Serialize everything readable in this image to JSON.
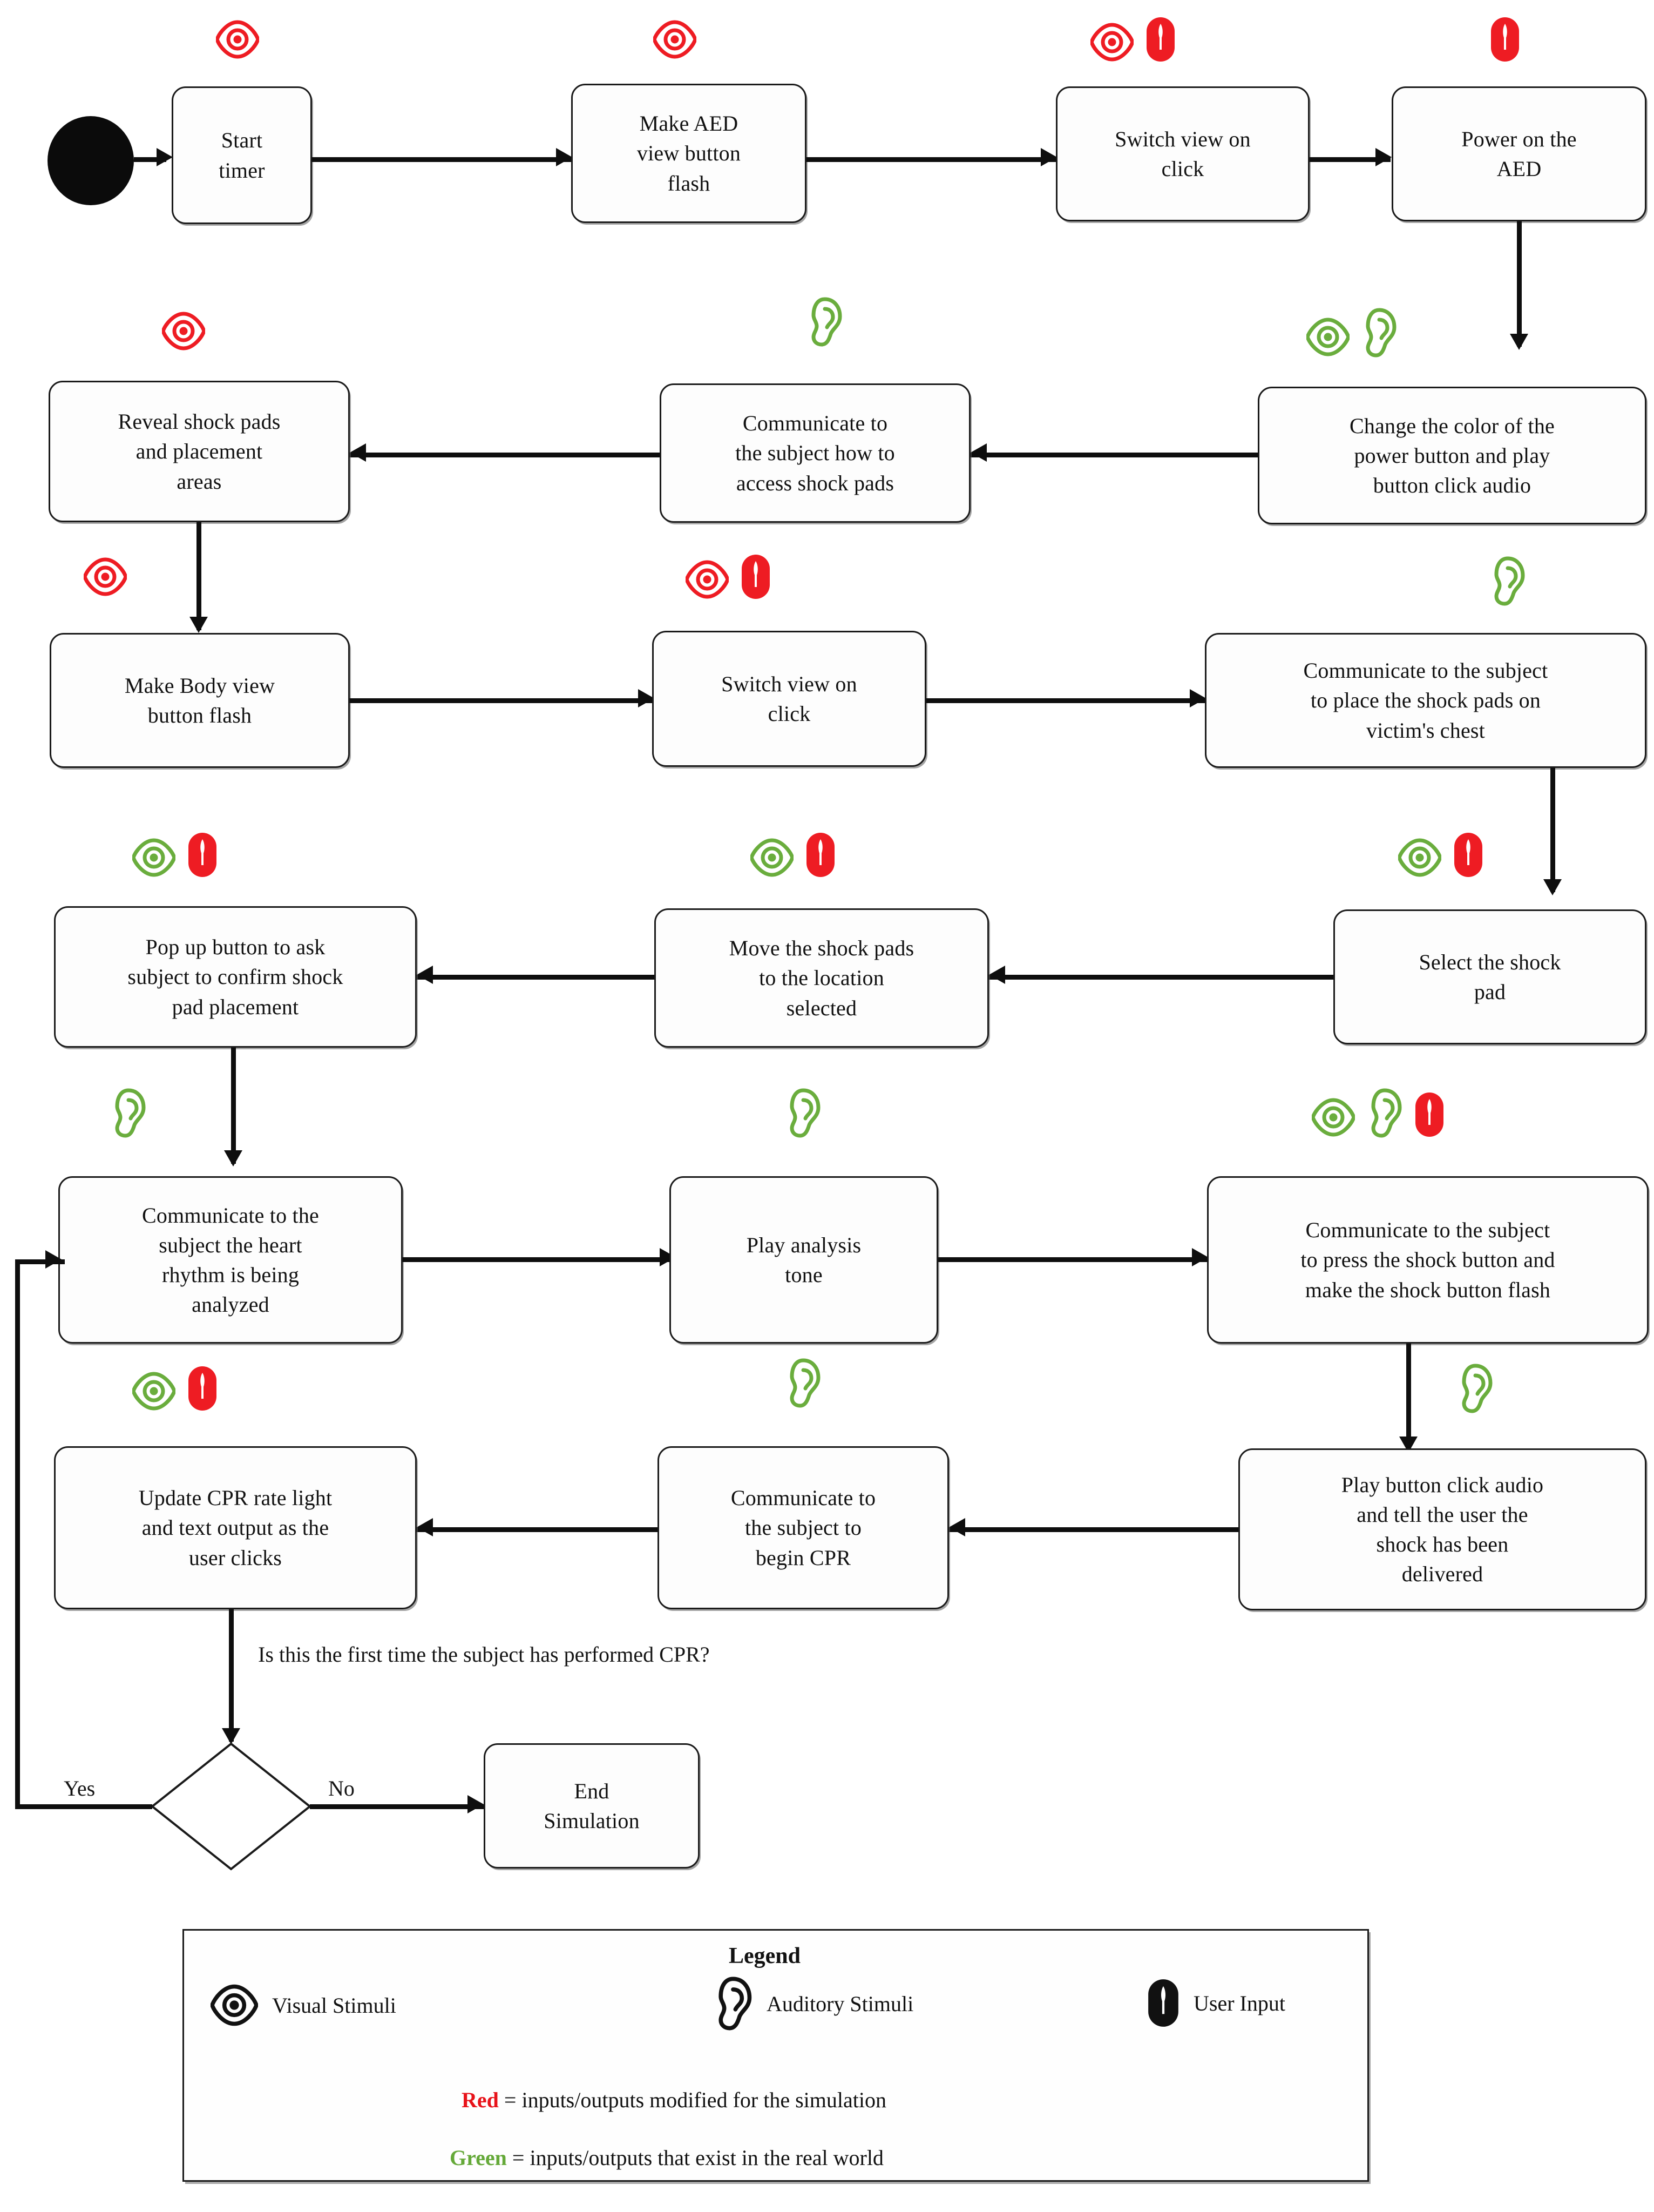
{
  "diagram": {
    "title": "AED simulation interaction flowchart",
    "colors": {
      "red": "#ee1c23",
      "green": "#6aad3d",
      "black": "#0e0e0e",
      "box_border": "#1a1a1a",
      "box_fill": "#fdfdfd"
    },
    "nodes": [
      {
        "id": "start",
        "label": "",
        "shape": "start-circle"
      },
      {
        "id": "n1",
        "label": "Start\ntimer",
        "shape": "process",
        "icons": [
          "eye-red"
        ]
      },
      {
        "id": "n2",
        "label": "Make  AED\nview button\nflash",
        "shape": "process",
        "icons": [
          "eye-red"
        ]
      },
      {
        "id": "n3",
        "label": "Switch view on\nclick",
        "shape": "process",
        "icons": [
          "eye-red",
          "mouse-red"
        ]
      },
      {
        "id": "n4",
        "label": "Power on the\nAED",
        "shape": "process",
        "icons": [
          "mouse-red"
        ]
      },
      {
        "id": "n5",
        "label": "Change the color of the\npower button and play\nbutton click audio",
        "shape": "process",
        "icons": [
          "eye-green",
          "ear-green"
        ]
      },
      {
        "id": "n6",
        "label": "Communicate to\nthe subject how to\naccess shock pads",
        "shape": "process",
        "icons": [
          "ear-green"
        ]
      },
      {
        "id": "n7",
        "label": "Reveal shock pads\nand placement\nareas",
        "shape": "process",
        "icons": [
          "eye-red"
        ]
      },
      {
        "id": "n8",
        "label": "Make Body view\nbutton flash",
        "shape": "process",
        "icons": [
          "eye-red"
        ]
      },
      {
        "id": "n9",
        "label": "Switch view on\nclick",
        "shape": "process",
        "icons": [
          "eye-red",
          "mouse-red"
        ]
      },
      {
        "id": "n10",
        "label": "Communicate to the subject\nto place the shock pads on\nvictim's chest",
        "shape": "process",
        "icons": [
          "ear-green"
        ]
      },
      {
        "id": "n11",
        "label": "Select the shock\npad",
        "shape": "process",
        "icons": [
          "eye-green",
          "mouse-red"
        ]
      },
      {
        "id": "n12",
        "label": "Move the shock pads\nto the location\nselected",
        "shape": "process",
        "icons": [
          "eye-green",
          "mouse-red"
        ]
      },
      {
        "id": "n13",
        "label": "Pop up button to ask\nsubject to confirm shock\npad placement",
        "shape": "process",
        "icons": [
          "eye-green",
          "mouse-red"
        ]
      },
      {
        "id": "n14",
        "label": "Communicate to the\nsubject the heart\nrhythm is being\nanalyzed",
        "shape": "process",
        "icons": [
          "ear-green"
        ]
      },
      {
        "id": "n15",
        "label": "Play analysis\ntone",
        "shape": "process",
        "icons": [
          "ear-green"
        ]
      },
      {
        "id": "n16",
        "label": "Communicate to the subject\nto press the shock button and\nmake the shock button flash",
        "shape": "process",
        "icons": [
          "eye-green",
          "ear-green",
          "mouse-red"
        ]
      },
      {
        "id": "n17",
        "label": "Play button click audio\nand tell the user the\nshock has been\ndelivered",
        "shape": "process",
        "icons": [
          "ear-green"
        ]
      },
      {
        "id": "n18",
        "label": "Communicate to\nthe subject to\nbegin CPR",
        "shape": "process",
        "icons": [
          "ear-green"
        ]
      },
      {
        "id": "n19",
        "label": "Update CPR rate light\nand text output as the\nuser clicks",
        "shape": "process",
        "icons": [
          "eye-green",
          "mouse-red"
        ]
      },
      {
        "id": "decision",
        "label": "",
        "shape": "diamond"
      },
      {
        "id": "n20",
        "label": "End\nSimulation",
        "shape": "process",
        "icons": []
      }
    ],
    "question_label": "Is this the first time the subject has performed CPR?",
    "branch_yes": "Yes",
    "branch_no": "No"
  },
  "legend": {
    "title": "Legend",
    "items": [
      {
        "icon": "eye-icon",
        "label": "Visual Stimuli"
      },
      {
        "icon": "ear-icon",
        "label": "Auditory Stimuli"
      },
      {
        "icon": "mouse-icon",
        "label": "User Input"
      }
    ],
    "notes": [
      {
        "keyword": "Red",
        "color": "#e8131a",
        "text": " = inputs/outputs modified for the simulation"
      },
      {
        "keyword": "Green",
        "color": "#65a939",
        "text": " = inputs/outputs that exist in the real world"
      }
    ]
  }
}
